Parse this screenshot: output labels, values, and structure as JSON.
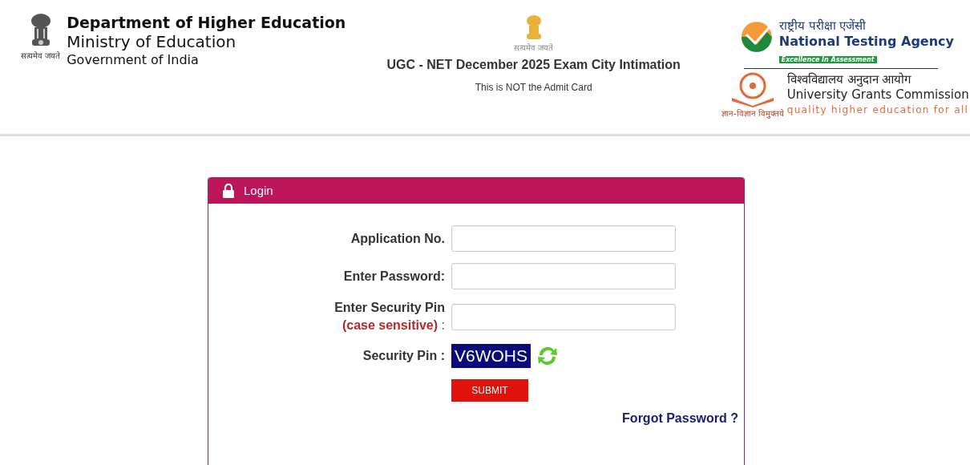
{
  "header": {
    "emblem_motto": "सत्यमेव जयते",
    "department": "Department of Higher Education",
    "ministry": "Ministry of Education",
    "government": "Government of India",
    "center_motto": "सत्यमेव जयते",
    "exam_title": "UGC - NET December 2025 Exam City Intimation",
    "notice": "This is NOT the Admit Card",
    "nta": {
      "hindi": "राष्ट्रीय परीक्षा एजेंसी",
      "name": "National Testing Agency",
      "tagline": "Excellence In Assessment"
    },
    "ugc": {
      "hindi": "विश्वविद्यालय अनुदान आयोग",
      "name": "University Grants Commission",
      "tagline": "quality higher education for all",
      "motto": "ज्ञान-विज्ञान विमुक्तये"
    }
  },
  "login": {
    "title": "Login",
    "fields": [
      {
        "label": "Application No."
      },
      {
        "label": "Enter Password:"
      },
      {
        "label": "Enter Security Pin",
        "note": "(case sensitive)",
        "suffix": ":"
      }
    ],
    "captcha": {
      "label": "Security Pin :",
      "code": "V6WOHS"
    },
    "submit": "SUBMIT",
    "forgot": "Forgot Password ?"
  }
}
